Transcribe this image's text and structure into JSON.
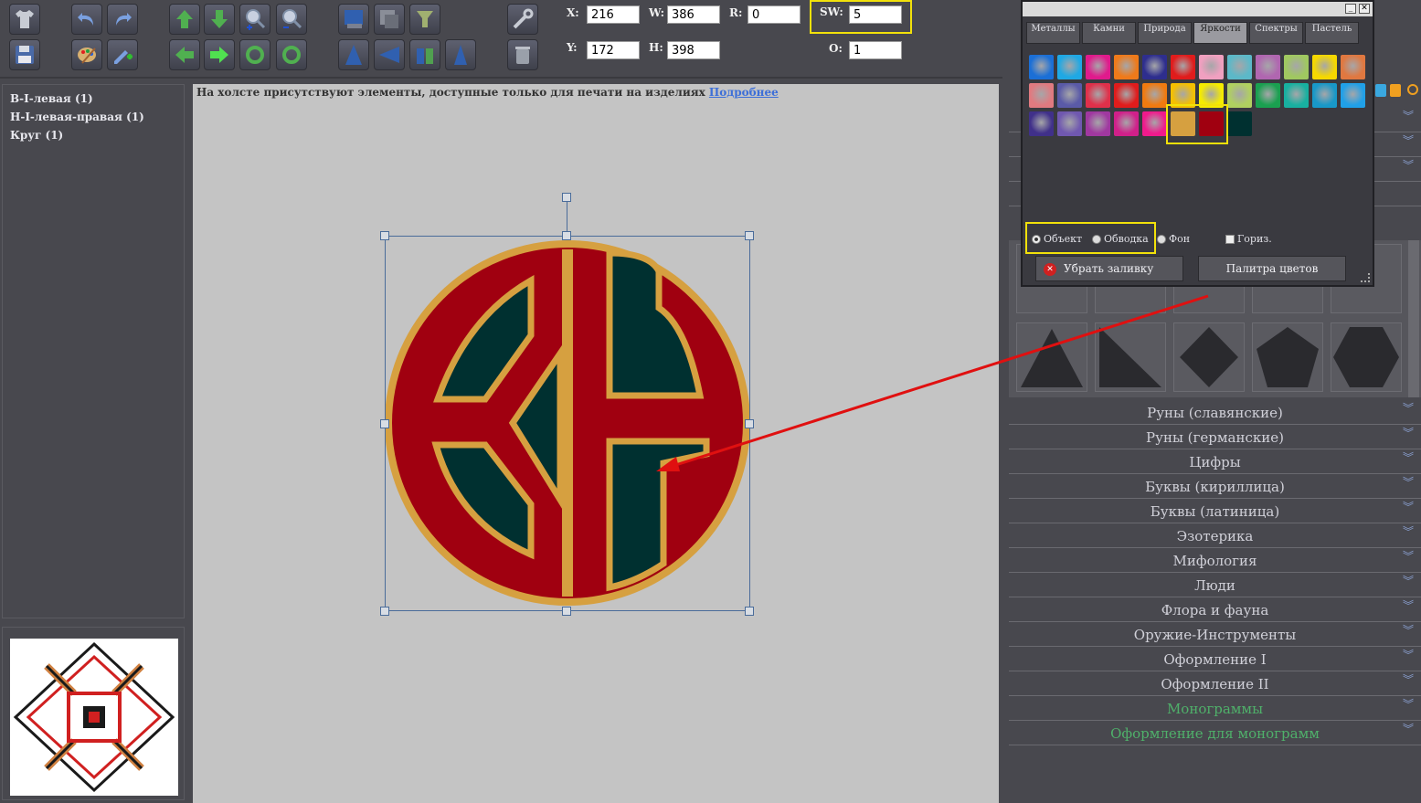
{
  "toolbar": {
    "fields": {
      "x_label": "X:",
      "x_value": "216",
      "y_label": "Y:",
      "y_value": "172",
      "w_label": "W:",
      "w_value": "386",
      "h_label": "H:",
      "h_value": "398",
      "r_label": "R:",
      "r_value": "0",
      "sw_label": "SW:",
      "sw_value": "5",
      "o_label": "O:",
      "o_value": "1"
    }
  },
  "layers": {
    "items": [
      {
        "label": "В-I-левая (1)"
      },
      {
        "label": "Н-I-левая-правая (1)"
      },
      {
        "label": "Круг (1)"
      }
    ]
  },
  "canvas": {
    "notice": "На холсте присутствуют элементы, доступные только для печати на изделиях",
    "notice_link": "Подробнее"
  },
  "palette": {
    "tabs": [
      {
        "label": "Металлы"
      },
      {
        "label": "Камни"
      },
      {
        "label": "Природа"
      },
      {
        "label": "Яркости"
      },
      {
        "label": "Спектры"
      },
      {
        "label": "Пастель"
      }
    ],
    "active_tab": "Яркости",
    "swatches": [
      [
        "#1b6fd6",
        "#1fa8e4",
        "#e01a8c",
        "#ef7a1a",
        "#2e2e8e",
        "#e01c1c",
        "#f0a0c0",
        "#5cb8c8",
        "#b066b0",
        "#a0c860",
        "#f5d800",
        "#e07840"
      ],
      [
        "#e07a80",
        "#5a5aa8",
        "#e0304a",
        "#e01c1c",
        "#f07a10",
        "#f5c000",
        "#f5ec00",
        "#b0d060",
        "#1aa050",
        "#18b0a0",
        "#1898c8",
        "#20a0e8"
      ],
      [
        "#40308a",
        "#7058b0",
        "#a038a0",
        "#d0208a",
        "#f01a8c",
        "#d6a040",
        "#a00010",
        "#003030"
      ]
    ],
    "selected_color": "#d6a040",
    "radio_object": "Объект",
    "radio_stroke": "Обводка",
    "radio_background": "Фон",
    "checkbox_horizontal": "Гориз.",
    "remove_fill": "Убрать заливку",
    "color_palette": "Палитра цветов"
  },
  "categories": [
    {
      "label": "Руны (славянские)",
      "green": false
    },
    {
      "label": "Руны (германские)",
      "green": false
    },
    {
      "label": "Цифры",
      "green": false
    },
    {
      "label": "Буквы (кириллица)",
      "green": false
    },
    {
      "label": "Буквы (латиница)",
      "green": false
    },
    {
      "label": "Эзотерика",
      "green": false
    },
    {
      "label": "Мифология",
      "green": false
    },
    {
      "label": "Люди",
      "green": false
    },
    {
      "label": "Флора и фауна",
      "green": false
    },
    {
      "label": "Оружие-Инструменты",
      "green": false
    },
    {
      "label": "Оформление I",
      "green": false
    },
    {
      "label": "Оформление II",
      "green": false
    },
    {
      "label": "Монограммы",
      "green": true
    },
    {
      "label": "Оформление для монограмм",
      "green": true
    }
  ],
  "colors": {
    "circle_fill": "#a00010",
    "circle_stroke": "#d6a040",
    "inner_fill": "#003030",
    "highlight": "#f2e10a",
    "arrow": "#e01010"
  }
}
